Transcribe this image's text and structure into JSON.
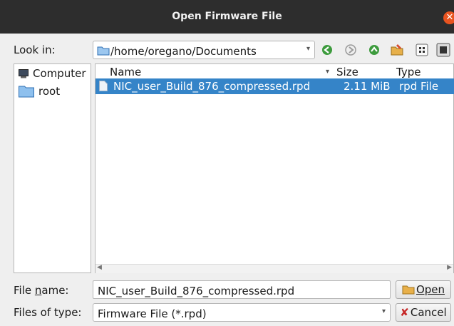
{
  "window": {
    "title": "Open Firmware File"
  },
  "look_in": {
    "label": "Look in:",
    "path": "/home/oregano/Documents"
  },
  "sidebar": {
    "items": [
      {
        "label": "Computer"
      },
      {
        "label": "root"
      }
    ]
  },
  "columns": {
    "name": "Name",
    "size": "Size",
    "type": "Type"
  },
  "files": [
    {
      "name": "NIC_user_Build_876_compressed.rpd",
      "size": "2.11 MiB",
      "type": "rpd File"
    }
  ],
  "file_name": {
    "label_prefix": "File ",
    "label_mnemonic": "n",
    "label_suffix": "ame:",
    "value": "NIC_user_Build_876_compressed.rpd"
  },
  "files_of_type": {
    "label": "Files of type:",
    "value": "Firmware File (*.rpd)"
  },
  "buttons": {
    "open": "Open",
    "cancel": "Cancel"
  },
  "colors": {
    "selection": "#3584c8",
    "titlebar": "#2d2d2d",
    "close": "#e95420"
  }
}
